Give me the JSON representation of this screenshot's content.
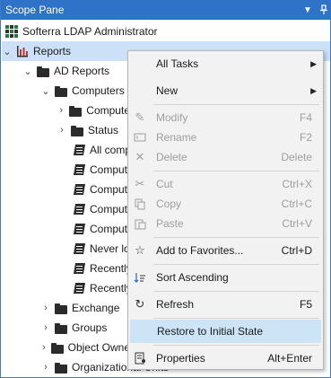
{
  "pane": {
    "title": "Scope Pane",
    "dropdown_icon": "chevron-down-icon",
    "pin_icon": "pin-icon"
  },
  "tree": {
    "root_label": "Softerra LDAP Administrator",
    "reports_label": "Reports",
    "ad_reports_label": "AD Reports",
    "computers_label": "Computers",
    "computers_child_1": "Compute",
    "status_label": "Status",
    "all_computers_label": "All compu",
    "report_items": [
      "Compute",
      "Compute",
      "Compute",
      "Compute"
    ],
    "never_logged_label": "Never lo",
    "recently_1": "Recently",
    "recently_2": "Recently",
    "exchange_label": "Exchange",
    "groups_label": "Groups",
    "object_owners_label": "Object Owne",
    "org_units_label": "Organizational Units"
  },
  "menu": {
    "all_tasks": "All Tasks",
    "new": "New",
    "modify": "Modify",
    "modify_sc": "F4",
    "rename": "Rename",
    "rename_sc": "F2",
    "delete": "Delete",
    "delete_sc": "Delete",
    "cut": "Cut",
    "cut_sc": "Ctrl+X",
    "copy": "Copy",
    "copy_sc": "Ctrl+C",
    "paste": "Paste",
    "paste_sc": "Ctrl+V",
    "add_fav": "Add to Favorites...",
    "add_fav_sc": "Ctrl+D",
    "sort_asc": "Sort Ascending",
    "refresh": "Refresh",
    "refresh_sc": "F5",
    "restore": "Restore to Initial State",
    "properties": "Properties",
    "properties_sc": "Alt+Enter"
  },
  "colors": {
    "titlebar": "#2e73c8",
    "selection": "#cce0f7",
    "menu_highlight": "#cde4f7"
  }
}
